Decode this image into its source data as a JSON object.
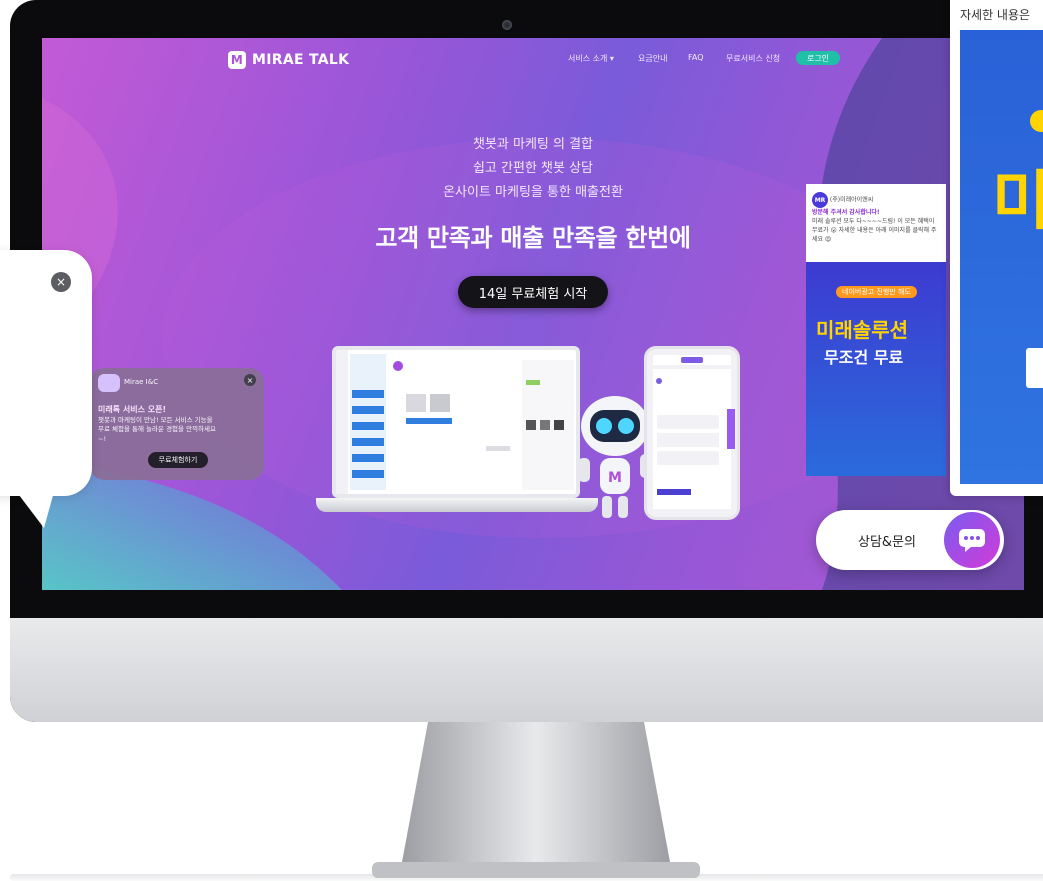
{
  "nav": {
    "logo": "MIRAE TALK",
    "items": [
      "서비스 소개 ▾",
      "요금안내",
      "FAQ",
      "무료서비스 신청"
    ],
    "login": "로그인"
  },
  "hero": {
    "lines": [
      "챗봇과 마케팅 의 결합",
      "쉽고 간편한 챗봇 상담",
      "온사이트 마케팅을 통한 매출전환"
    ],
    "headline": "고객 만족과 매출 만족을 한번에",
    "cta": "14일 무료체험 시작"
  },
  "chat_popup": {
    "name": "Mirae I&C",
    "title": "미래톡 서비스 오픈!",
    "message": "챗봇과 마케팅이 만남! 모든 서비스 기능을 무료 체험을 통해 놀라운 경험을 만끽하세요~!",
    "button": "무료체험하기"
  },
  "promo": {
    "company": "(주)미래아이앤씨",
    "title": "방문해 주셔서 감사합니다!",
    "text": "미래 솔루션 모두 다~~~~드림! 이 모든 혜택이 무료가 😮 자세한 내용은 아래 이미지를 클릭해 주세요 😍",
    "badge": "네이버광고 진행만 해도",
    "big": "미래솔루션",
    "big2": "무조건 무료"
  },
  "consult": {
    "label": "상담&문의"
  },
  "overlay": {
    "caption": "자세한 내용은",
    "big": "미"
  },
  "colors": {
    "accent": "#20bfa8",
    "brand": "#b052d6",
    "cta_bg": "#141418"
  }
}
